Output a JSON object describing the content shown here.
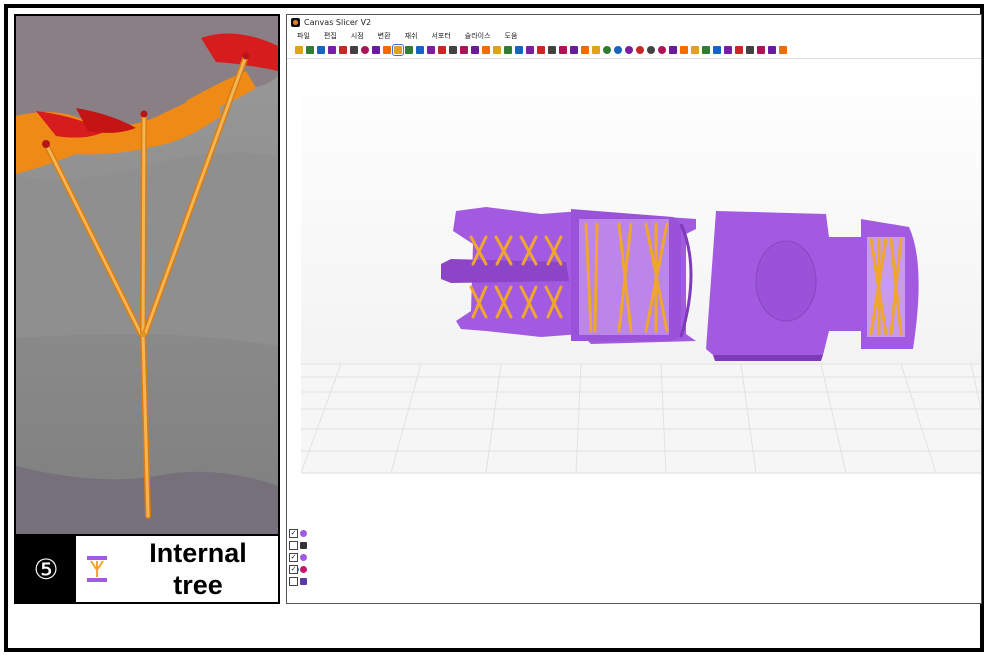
{
  "caption": {
    "number": "⑤",
    "label": "Internal\ntree",
    "icon": "internal-tree-icon"
  },
  "app": {
    "title": "Canvas Slicer V2",
    "menu": [
      "파일",
      "편집",
      "시점",
      "변환",
      "재쉬",
      "서포터",
      "슬라이스",
      "도움"
    ],
    "toolbar_icons": [
      "new-icon",
      "open-icon",
      "save-icon",
      "export-icon",
      "undo-icon",
      "redo-icon",
      "sphere-icon",
      "cube-icon",
      "cube-icon",
      "cube-icon",
      "cube-icon",
      "cube-icon",
      "support-a-icon",
      "support-b-icon",
      "support-c-icon",
      "align-icon",
      "align-icon",
      "align-icon",
      "move-icon",
      "rotate-icon",
      "refresh-icon",
      "grid-icon",
      "cone-icon",
      "grid-icon",
      "pencil-icon",
      "flag-icon",
      "grid-icon",
      "measure-icon",
      "circle-icon",
      "circle-icon",
      "circle-icon",
      "circle-icon",
      "circle-icon",
      "circle-icon",
      "line-icon",
      "line-icon",
      "bar-icon",
      "bar-icon",
      "bar-icon",
      "bar-icon",
      "dot-icon",
      "check-icon",
      "brush-icon",
      "cross-icon",
      "export-icon"
    ],
    "layers": [
      {
        "checked": false,
        "icon": "model-icon"
      },
      {
        "checked": false,
        "icon": "grid-icon"
      },
      {
        "checked": true,
        "icon": "support-icon"
      },
      {
        "checked": true,
        "icon": "sphere-icon"
      },
      {
        "checked": false,
        "icon": "tree-icon"
      }
    ]
  },
  "colors": {
    "part": "#a25be0",
    "part_dark": "#7d3bb8",
    "support": "#f0a62e",
    "support_dark": "#d87d12",
    "render_bg": "#8d8d8d",
    "accent": "#1e7fe0"
  }
}
